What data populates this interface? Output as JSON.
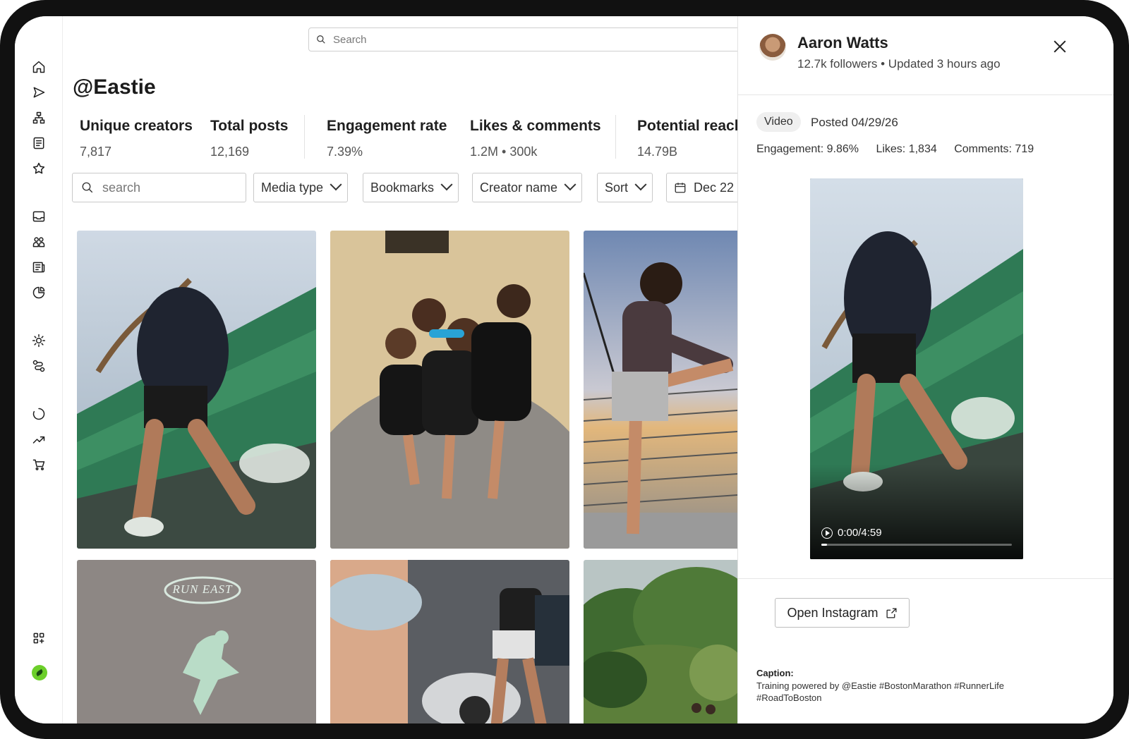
{
  "search": {
    "placeholder": "Search"
  },
  "page": {
    "title": "@Eastie"
  },
  "stats": [
    {
      "label": "Unique creators",
      "value": "7,817"
    },
    {
      "label": "Total posts",
      "value": "12,169"
    },
    {
      "label": "Engagement rate",
      "value": "7.39%"
    },
    {
      "label": "Likes & comments",
      "value": "1.2M • 300k"
    },
    {
      "label": "Potential reach",
      "value": "14.79B"
    }
  ],
  "filters": {
    "search_placeholder": "search",
    "media_type": "Media type",
    "bookmarks": "Bookmarks",
    "creator_name": "Creator name",
    "sort": "Sort",
    "date": "Dec 22"
  },
  "tiles": {
    "run_east_text": "RUN EAST"
  },
  "sidebar": {
    "icons": [
      "home-icon",
      "send-icon",
      "hierarchy-icon",
      "document-icon",
      "star-icon",
      "inbox-icon",
      "people-icon",
      "newspaper-icon",
      "pie-chart-icon",
      "lightbulb-icon",
      "route-icon",
      "loading-icon",
      "trend-up-icon",
      "cart-icon",
      "apps-icon"
    ]
  },
  "panel": {
    "name": "Aaron Watts",
    "subtitle": "12.7k followers • Updated 3 hours ago",
    "badge": "Video",
    "posted": "Posted 04/29/26",
    "engagement": "Engagement: 9.86%",
    "likes": "Likes: 1,834",
    "comments": "Comments: 719",
    "video_time": "0:00/4:59",
    "video_progress": 0.03,
    "open_button": "Open Instagram",
    "caption_label": "Caption:",
    "caption": "Training powered by @Eastie #BostonMarathon #RunnerLife #RoadToBoston"
  }
}
